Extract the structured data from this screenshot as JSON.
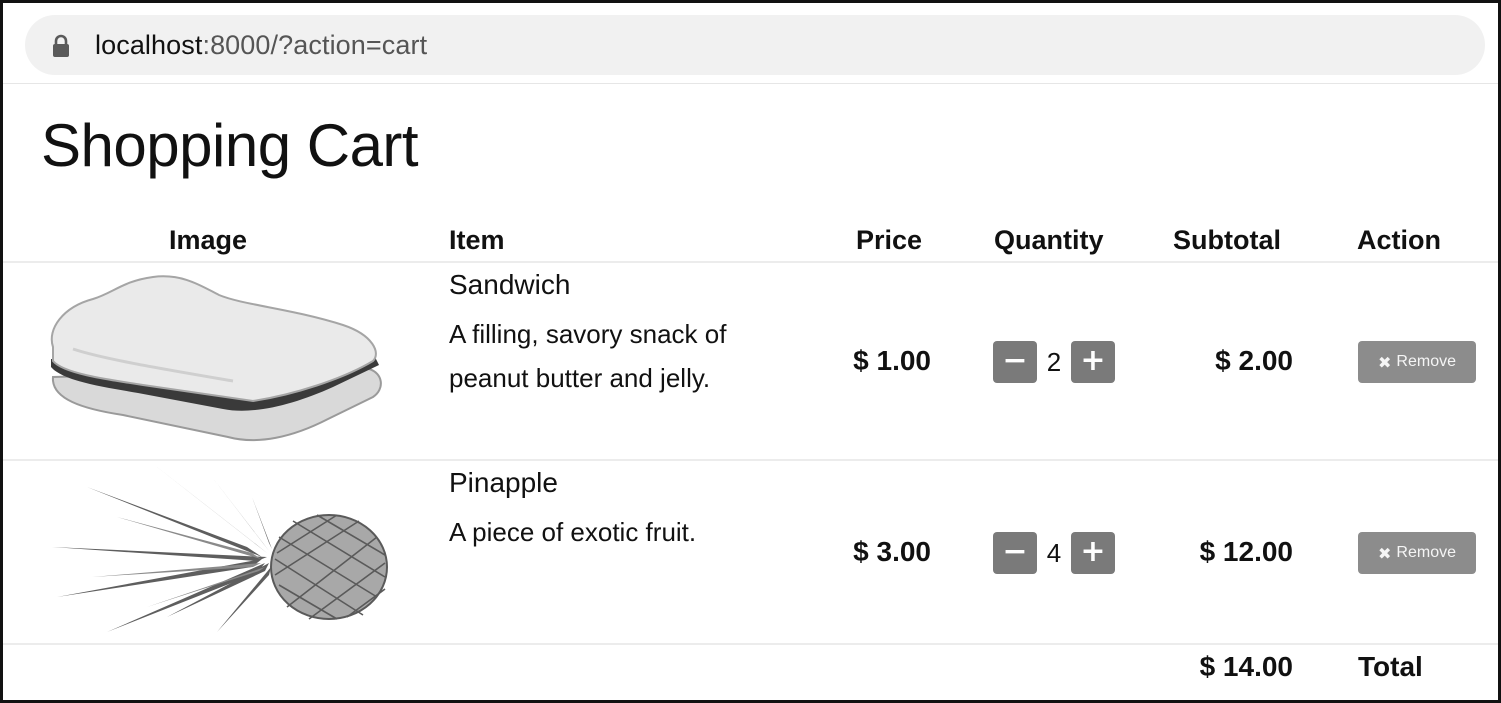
{
  "browser": {
    "url_host": "localhost",
    "url_rest": ":8000/?action=cart"
  },
  "page": {
    "title": "Shopping Cart"
  },
  "table": {
    "headers": {
      "image": "Image",
      "item": "Item",
      "price": "Price",
      "quantity": "Quantity",
      "subtotal": "Subtotal",
      "action": "Action"
    },
    "rows": [
      {
        "image_icon": "sandwich-image",
        "name": "Sandwich",
        "description_line1": "A filling, savory snack of",
        "description_line2": "peanut butter and jelly.",
        "price": "$ 1.00",
        "quantity": "2",
        "subtotal": "$ 2.00",
        "remove_label": "Remove"
      },
      {
        "image_icon": "pineapple-image",
        "name": "Pinapple",
        "description_line1": "A piece of exotic fruit.",
        "description_line2": "",
        "price": "$ 3.00",
        "quantity": "4",
        "subtotal": "$ 12.00",
        "remove_label": "Remove"
      }
    ],
    "total_value": "$ 14.00",
    "total_label": "Total"
  },
  "controls": {
    "minus_glyph": "−",
    "plus_glyph": "+",
    "remove_glyph": "✖"
  }
}
